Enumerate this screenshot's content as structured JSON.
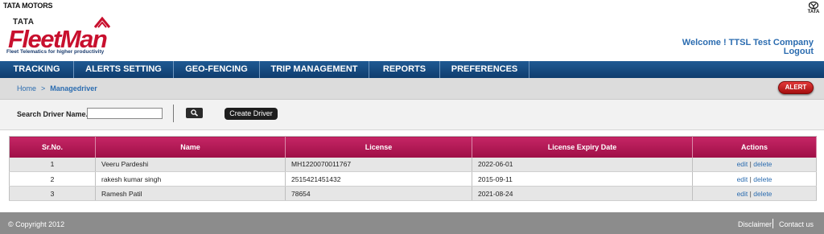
{
  "header": {
    "brand_top_left": "TATA MOTORS",
    "brand_top_right": "TATA",
    "logo_tata": "TATA",
    "logo_product": "FleetMan",
    "logo_tagline": "Fleet Telematics for higher productivity",
    "welcome": "Welcome ! TTSL Test Company",
    "logout": "Logout"
  },
  "nav": {
    "items": [
      "TRACKING",
      "ALERTS SETTING",
      "GEO-FENCING",
      "TRIP MANAGEMENT",
      "REPORTS",
      "PREFERENCES"
    ]
  },
  "breadcrumb": {
    "home": "Home",
    "separator": ">",
    "current": "Managedriver"
  },
  "alert_button": "ALERT",
  "search": {
    "label": "Search Driver Name.:",
    "value": "",
    "search_icon": "search-icon",
    "create_label": "Create Driver"
  },
  "table": {
    "headers": [
      "Sr.No.",
      "Name",
      "License",
      "License Expiry Date",
      "Actions"
    ],
    "rows": [
      {
        "sr": "1",
        "name": "Veeru Pardeshi",
        "license": "MH1220070011767",
        "expiry": "2022-06-01",
        "edit": "edit",
        "pipe": "|",
        "delete": "delete"
      },
      {
        "sr": "2",
        "name": "rakesh kumar singh",
        "license": "2515421451432",
        "expiry": "2015-09-11",
        "edit": "edit",
        "pipe": "|",
        "delete": "delete"
      },
      {
        "sr": "3",
        "name": "Ramesh Patil",
        "license": "78654",
        "expiry": "2021-08-24",
        "edit": "edit",
        "pipe": "|",
        "delete": "delete"
      }
    ]
  },
  "footer": {
    "copyright": "© Copyright 2012",
    "disclaimer": "Disclaimer",
    "contact": "Contact us"
  },
  "colors": {
    "nav": "#0f3d6e",
    "table_header": "#b01a55",
    "brand_red": "#c8102e",
    "link": "#2b6cb0"
  }
}
